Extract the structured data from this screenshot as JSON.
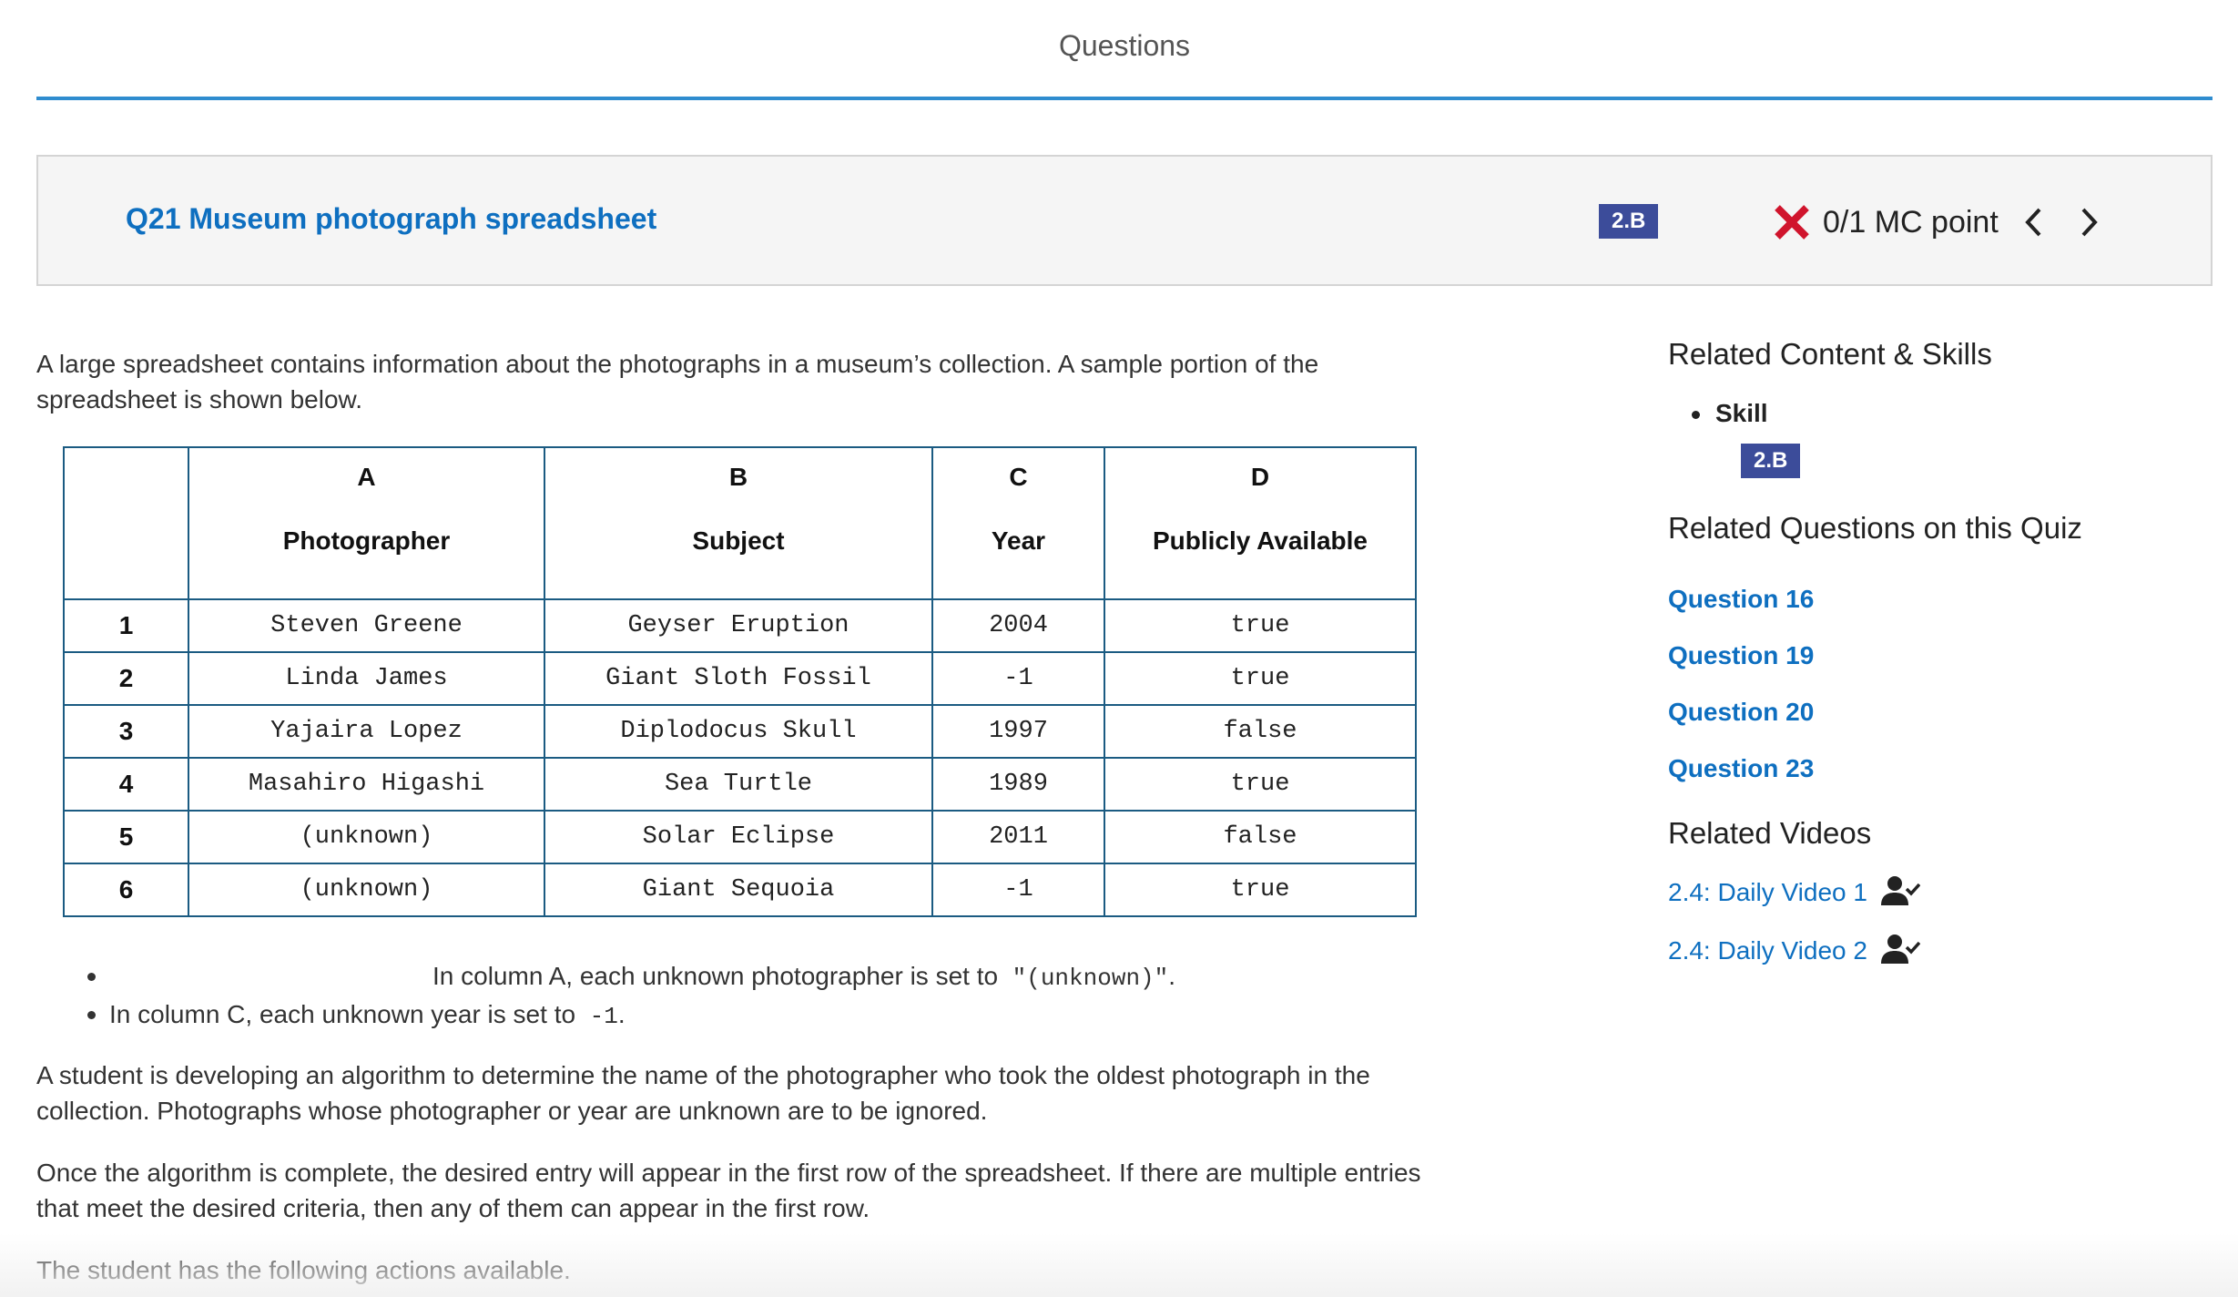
{
  "header": {
    "title": "Questions"
  },
  "question": {
    "title": "Q21 Museum photograph spreadsheet",
    "skill_badge": "2.B",
    "score": "0/1 MC point",
    "status_icon": "x-mark-icon",
    "status_color": "#d0142c"
  },
  "content": {
    "intro": "A large spreadsheet contains information about the photographs in a museum’s collection. A sample portion of the spreadsheet is shown below.",
    "table": {
      "columns": [
        {
          "letter": "",
          "name": ""
        },
        {
          "letter": "A",
          "name": "Photographer"
        },
        {
          "letter": "B",
          "name": "Subject"
        },
        {
          "letter": "C",
          "name": "Year"
        },
        {
          "letter": "D",
          "name": "Publicly Available"
        }
      ],
      "rows": [
        [
          "1",
          "Steven Greene",
          "Geyser Eruption",
          "2004",
          "true"
        ],
        [
          "2",
          "Linda James",
          "Giant Sloth Fossil",
          "-1",
          "true"
        ],
        [
          "3",
          "Yajaira Lopez",
          "Diplodocus Skull",
          "1997",
          "false"
        ],
        [
          "4",
          "Masahiro Higashi",
          "Sea Turtle",
          "1989",
          "true"
        ],
        [
          "5",
          "(unknown)",
          "Solar Eclipse",
          "2011",
          "false"
        ],
        [
          "6",
          "(unknown)",
          "Giant Sequoia",
          "-1",
          "true"
        ]
      ]
    },
    "bullets": [
      {
        "text": "In column A, each unknown photographer is set to",
        "code": "\"(unknown)\"",
        "suffix": "."
      },
      {
        "text": "In column C, each unknown year is set to",
        "code": "-1",
        "suffix": "."
      }
    ],
    "para2": "A student is developing an algorithm to determine the name of the photographer who took the oldest photograph in the collection. Photographs whose photographer or year are unknown are to be ignored.",
    "para3": "Once the algorithm is complete, the desired entry will appear in the first row of the spreadsheet. If there are multiple entries that meet the desired criteria, then any of them can appear in the first row.",
    "para4": "The student has the following actions available."
  },
  "sidebar": {
    "content_heading": "Related Content & Skills",
    "skill_label": "Skill",
    "skill_badge": "2.B",
    "questions_heading": "Related Questions on this Quiz",
    "questions": [
      "Question 16",
      "Question 19",
      "Question 20",
      "Question 23"
    ],
    "videos_heading": "Related Videos",
    "videos": [
      {
        "label": "2.4: Daily Video 1",
        "icon": "person-check-icon"
      },
      {
        "label": "2.4: Daily Video 2",
        "icon": "person-check-icon"
      }
    ]
  },
  "colors": {
    "accent_blue": "#2f8ccf",
    "link_blue": "#0e6fc0",
    "badge_bg": "#3c4c9a",
    "table_border": "#1b5b82"
  }
}
